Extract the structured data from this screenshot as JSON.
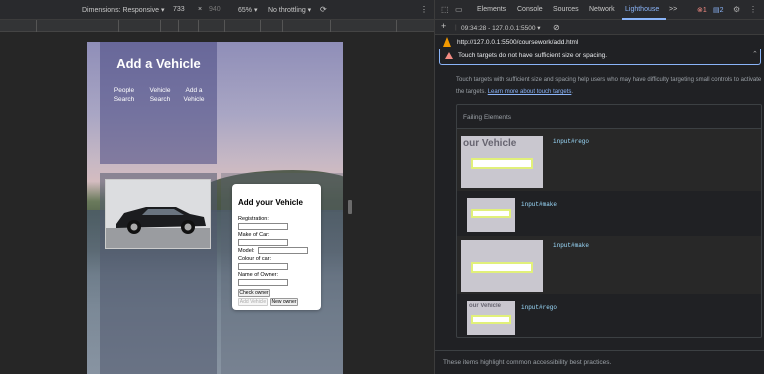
{
  "device_toolbar": {
    "dimensions_label": "Dimensions: Responsive ▾",
    "width": "733",
    "times": "×",
    "height": "940",
    "zoom": "65% ▾",
    "throttling": "No throttling ▾",
    "rotate_icon": "rotate-icon",
    "more_icon": "more-icon"
  },
  "page": {
    "hero_title": "Add a Vehicle",
    "nav": [
      {
        "line1": "People",
        "line2": "Search"
      },
      {
        "line1": "Vehicle",
        "line2": "Search"
      },
      {
        "line1": "Add a",
        "line2": "Vehicle"
      }
    ],
    "form": {
      "title": "Add your Vehicle",
      "registration_label": "Registration:",
      "make_label": "Make of Car:",
      "model_label": "Model:",
      "colour_label": "Colour of car:",
      "owner_label": "Name of Owner:",
      "check_owner_button": "Check owner",
      "add_vehicle_button": "Add Vehicle",
      "new_owner_button": "New owner"
    }
  },
  "devtools": {
    "tabs": [
      "Elements",
      "Console",
      "Sources",
      "Network",
      "Lighthouse",
      ">>"
    ],
    "active_tab": "Lighthouse",
    "errors": "1",
    "issues": "2",
    "report_label": "09:34:28 - 127.0.0.1:5500 ▾",
    "url": "http://127.0.0.1:5500/coursework/add.html",
    "audit_title": "Touch targets do not have sufficient size or spacing.",
    "audit_desc_1": "Touch targets with sufficient size and spacing help users who may have difficulty targeting small controls to activate the targets. ",
    "audit_link": "Learn more about touch targets",
    "audit_desc_2": ".",
    "failing_header": "Failing Elements",
    "items": [
      {
        "thumb_text": "our Vehicle",
        "selector": "input#rego"
      },
      {
        "thumb_text": "",
        "selector": "input#make"
      },
      {
        "thumb_text": "",
        "selector": "input#make"
      },
      {
        "thumb_text": "our Vehicle",
        "selector": "input#rego"
      }
    ],
    "footer": "These items highlight common accessibility best practices."
  },
  "colors": {
    "accent": "#8ab4f8",
    "error": "#f28b82",
    "highlight": "#e1f07a"
  }
}
